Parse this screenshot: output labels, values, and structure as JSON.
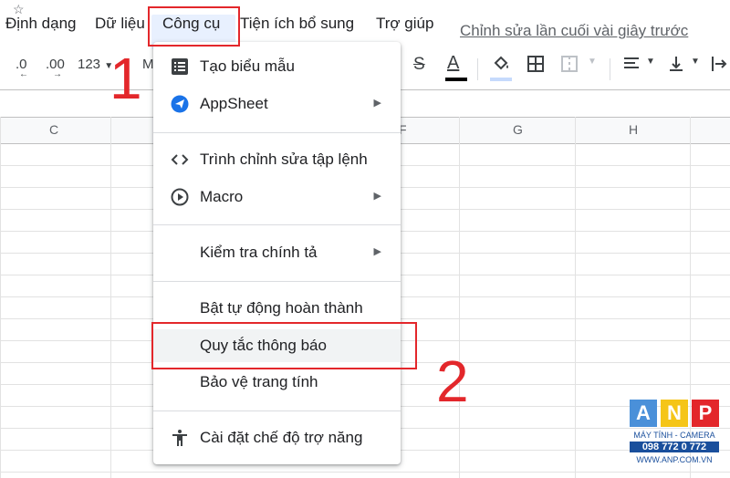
{
  "menubar": {
    "items": [
      "Định dạng",
      "Dữ liệu",
      "Công cụ",
      "Tiện ích bổ sung",
      "Trợ giúp"
    ],
    "last_edit": "Chỉnh sửa lần cuối vài giây trước"
  },
  "toolbar": {
    "decrease_decimal": ".0",
    "increase_decimal": ".00",
    "number_format": "123",
    "font_partial": "M"
  },
  "grid": {
    "column_headers": [
      "C",
      "F",
      "G",
      "H"
    ]
  },
  "dropdown": {
    "items": [
      {
        "label": "Tạo biểu mẫu",
        "icon": "form-icon",
        "submenu": false
      },
      {
        "label": "AppSheet",
        "icon": "appsheet-icon",
        "submenu": true
      },
      {
        "label": "Trình chỉnh sửa tập lệnh",
        "icon": "code-icon",
        "submenu": false
      },
      {
        "label": "Macro",
        "icon": "macro-icon",
        "submenu": true
      },
      {
        "label": "Kiểm tra chính tả",
        "icon": "",
        "submenu": true
      },
      {
        "label": "Bật tự động hoàn thành",
        "icon": "",
        "submenu": false
      },
      {
        "label": "Quy tắc thông báo",
        "icon": "",
        "submenu": false,
        "highlighted": true
      },
      {
        "label": "Bảo vệ trang tính",
        "icon": "",
        "submenu": false
      },
      {
        "label": "Cài đặt chế độ trợ năng",
        "icon": "accessibility-icon",
        "submenu": false
      }
    ]
  },
  "annotations": {
    "step1": "1",
    "step2": "2"
  },
  "logo": {
    "letters": [
      "A",
      "N",
      "P"
    ],
    "line1": "MÁY TÍNH - CAMERA",
    "line2": "098 772 0 772",
    "line3": "WWW.ANP.COM.VN"
  },
  "colors": {
    "annotation_red": "#e3272b",
    "menu_active_bg": "#e8f0fe",
    "text_color_bar": "#000000",
    "fill_color_bar": "#c6dafc",
    "logo_blue": "#4a90d9",
    "logo_yellow": "#f5c518",
    "logo_red": "#e3272b"
  }
}
